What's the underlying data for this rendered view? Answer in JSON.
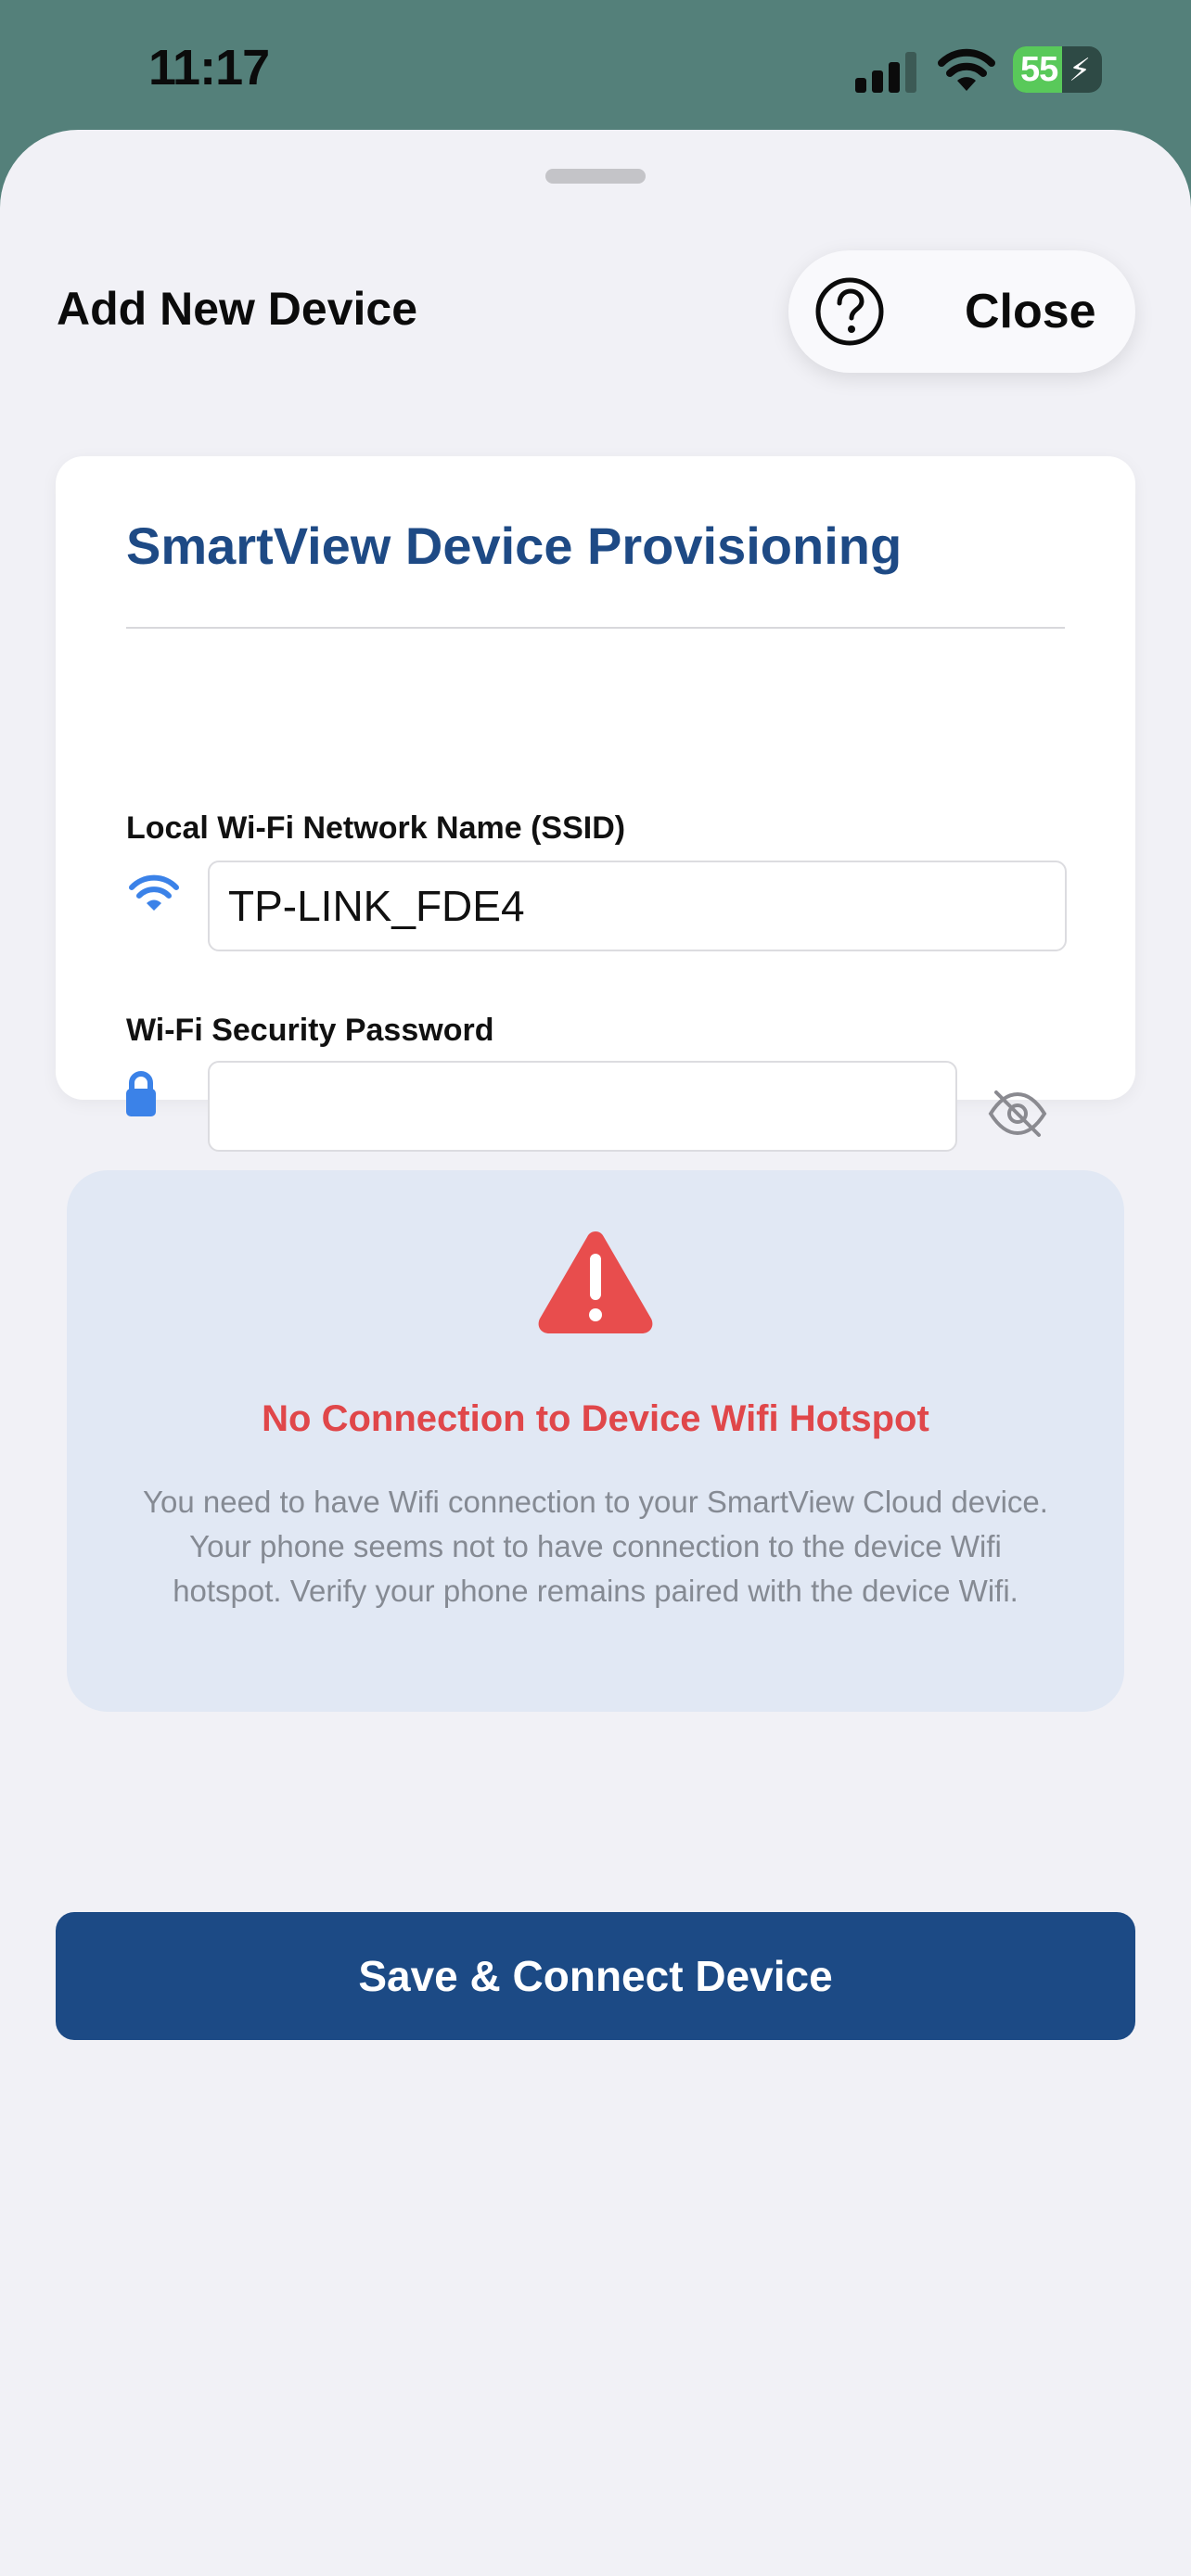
{
  "status_bar": {
    "time": "11:17",
    "battery_percent": "55",
    "battery_level": 0.55
  },
  "sheet": {
    "title": "Add New Device",
    "close_label": "Close",
    "help_icon": "question-circle-icon"
  },
  "card": {
    "title": "SmartView Device Provisioning",
    "ssid_label": "Local Wi-Fi Network Name (SSID)",
    "ssid_value": "TP-LINK_FDE4",
    "ssid_icon": "wifi-icon",
    "password_label": "Wi-Fi Security Password",
    "password_value": "",
    "password_icon": "lock-icon",
    "visibility_icon": "eye-slash-icon"
  },
  "warning": {
    "icon": "warning-triangle-icon",
    "title": "No Connection to Device Wifi Hotspot",
    "message": "You need to have Wifi connection to your SmartView Cloud device. Your phone seems not to have connection to the device Wifi hotspot. Verify your phone remains paired with the device Wifi.",
    "title_color": "#e0474a"
  },
  "actions": {
    "primary_label": "Save & Connect Device"
  },
  "colors": {
    "accent": "#1c4a85",
    "icon_blue": "#3b82e8",
    "header_bg": "#54807a"
  }
}
